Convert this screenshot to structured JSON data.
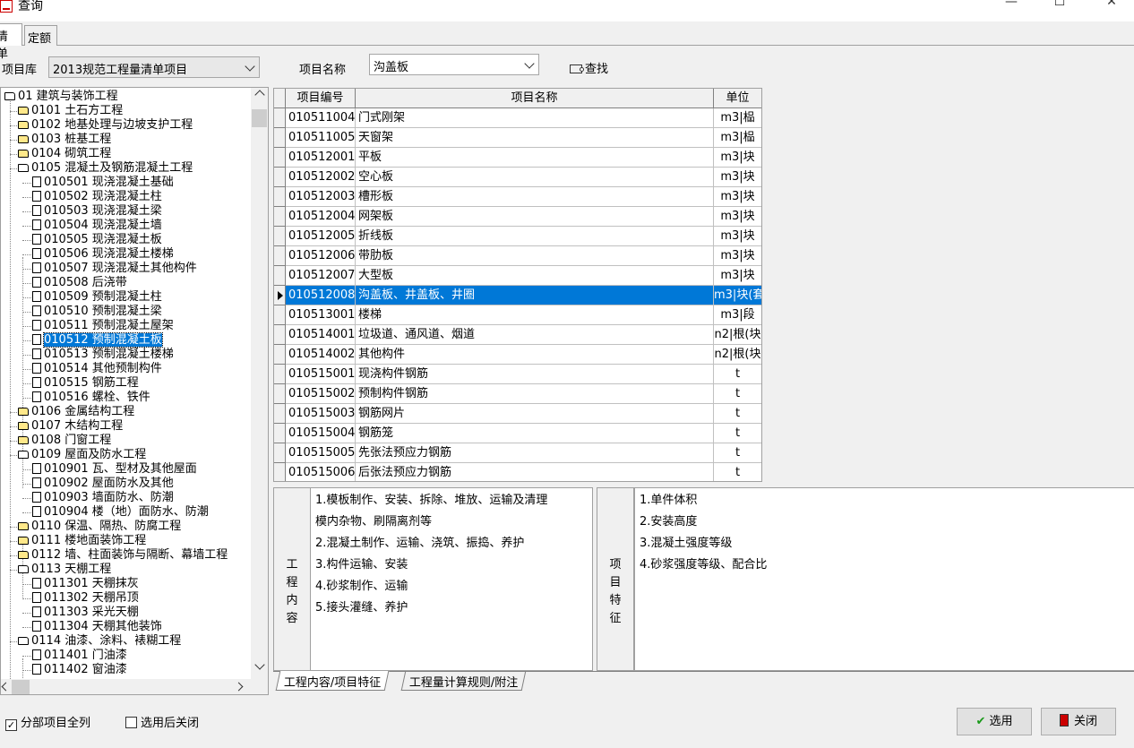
{
  "window": {
    "title": "查询",
    "min": "—",
    "max": "☐",
    "close": "✕"
  },
  "tabs": [
    "清单",
    "定额"
  ],
  "toolbar": {
    "library_label": "项目库",
    "library_value": "2013规范工程量清单项目",
    "name_label": "项目名称",
    "name_value": "沟盖板",
    "find_label": "查找"
  },
  "tree": [
    {
      "label": "01 建筑与装饰工程",
      "level": 0,
      "type": "folder-open"
    },
    {
      "label": "0101 土石方工程",
      "level": 1,
      "type": "folder"
    },
    {
      "label": "0102 地基处理与边坡支护工程",
      "level": 1,
      "type": "folder"
    },
    {
      "label": "0103 桩基工程",
      "level": 1,
      "type": "folder"
    },
    {
      "label": "0104 砌筑工程",
      "level": 1,
      "type": "folder"
    },
    {
      "label": "0105 混凝土及钢筋混凝土工程",
      "level": 1,
      "type": "folder-open"
    },
    {
      "label": "010501 现浇混凝土基础",
      "level": 2,
      "type": "doc"
    },
    {
      "label": "010502 现浇混凝土柱",
      "level": 2,
      "type": "doc"
    },
    {
      "label": "010503 现浇混凝土梁",
      "level": 2,
      "type": "doc"
    },
    {
      "label": "010504 现浇混凝土墙",
      "level": 2,
      "type": "doc"
    },
    {
      "label": "010505 现浇混凝土板",
      "level": 2,
      "type": "doc"
    },
    {
      "label": "010506 现浇混凝土楼梯",
      "level": 2,
      "type": "doc"
    },
    {
      "label": "010507 现浇混凝土其他构件",
      "level": 2,
      "type": "doc"
    },
    {
      "label": "010508 后浇带",
      "level": 2,
      "type": "doc"
    },
    {
      "label": "010509 预制混凝土柱",
      "level": 2,
      "type": "doc"
    },
    {
      "label": "010510 预制混凝土梁",
      "level": 2,
      "type": "doc"
    },
    {
      "label": "010511 预制混凝土屋架",
      "level": 2,
      "type": "doc"
    },
    {
      "label": "010512 预制混凝土板",
      "level": 2,
      "type": "doc",
      "selected": true
    },
    {
      "label": "010513 预制混凝土楼梯",
      "level": 2,
      "type": "doc"
    },
    {
      "label": "010514 其他预制构件",
      "level": 2,
      "type": "doc"
    },
    {
      "label": "010515 钢筋工程",
      "level": 2,
      "type": "doc"
    },
    {
      "label": "010516 螺栓、铁件",
      "level": 2,
      "type": "doc"
    },
    {
      "label": "0106 金属结构工程",
      "level": 1,
      "type": "folder"
    },
    {
      "label": "0107 木结构工程",
      "level": 1,
      "type": "folder"
    },
    {
      "label": "0108 门窗工程",
      "level": 1,
      "type": "folder"
    },
    {
      "label": "0109 屋面及防水工程",
      "level": 1,
      "type": "folder-open"
    },
    {
      "label": "010901 瓦、型材及其他屋面",
      "level": 2,
      "type": "doc"
    },
    {
      "label": "010902 屋面防水及其他",
      "level": 2,
      "type": "doc"
    },
    {
      "label": "010903 墙面防水、防潮",
      "level": 2,
      "type": "doc"
    },
    {
      "label": "010904 楼（地）面防水、防潮",
      "level": 2,
      "type": "doc"
    },
    {
      "label": "0110 保温、隔热、防腐工程",
      "level": 1,
      "type": "folder"
    },
    {
      "label": "0111 楼地面装饰工程",
      "level": 1,
      "type": "folder"
    },
    {
      "label": "0112 墙、柱面装饰与隔断、幕墙工程",
      "level": 1,
      "type": "folder"
    },
    {
      "label": "0113 天棚工程",
      "level": 1,
      "type": "folder-open"
    },
    {
      "label": "011301 天棚抹灰",
      "level": 2,
      "type": "doc"
    },
    {
      "label": "011302 天棚吊顶",
      "level": 2,
      "type": "doc"
    },
    {
      "label": "011303 采光天棚",
      "level": 2,
      "type": "doc"
    },
    {
      "label": "011304 天棚其他装饰",
      "level": 2,
      "type": "doc"
    },
    {
      "label": "0114 油漆、涂料、裱糊工程",
      "level": 1,
      "type": "folder-open"
    },
    {
      "label": "011401 门油漆",
      "level": 2,
      "type": "doc"
    },
    {
      "label": "011402 窗油漆",
      "level": 2,
      "type": "doc"
    }
  ],
  "grid": {
    "columns": [
      "项目编号",
      "项目名称",
      "单位"
    ],
    "rows": [
      [
        "010511004",
        "门式刚架",
        "m3|榀"
      ],
      [
        "010511005",
        "天窗架",
        "m3|榀"
      ],
      [
        "010512001",
        "平板",
        "m3|块"
      ],
      [
        "010512002",
        "空心板",
        "m3|块"
      ],
      [
        "010512003",
        "槽形板",
        "m3|块"
      ],
      [
        "010512004",
        "网架板",
        "m3|块"
      ],
      [
        "010512005",
        "折线板",
        "m3|块"
      ],
      [
        "010512006",
        "带肋板",
        "m3|块"
      ],
      [
        "010512007",
        "大型板",
        "m3|块"
      ],
      [
        "010512008",
        "沟盖板、井盖板、井圈",
        "m3|块(套"
      ],
      [
        "010513001",
        "楼梯",
        "m3|段"
      ],
      [
        "010514001",
        "垃圾道、通风道、烟道",
        "n2|根(块"
      ],
      [
        "010514002",
        "其他构件",
        "n2|根(块"
      ],
      [
        "010515001",
        "现浇构件钢筋",
        "t"
      ],
      [
        "010515002",
        "预制构件钢筋",
        "t"
      ],
      [
        "010515003",
        "钢筋网片",
        "t"
      ],
      [
        "010515004",
        "钢筋笼",
        "t"
      ],
      [
        "010515005",
        "先张法预应力钢筋",
        "t"
      ],
      [
        "010515006",
        "后张法预应力钢筋",
        "t"
      ]
    ],
    "selected_index": 9
  },
  "work_content": {
    "label": "工程内容",
    "lines": [
      "1.模板制作、安装、拆除、堆放、运输及清理",
      "模内杂物、刷隔离剂等",
      "2.混凝土制作、运输、浇筑、振捣、养护",
      "3.构件运输、安装",
      "4.砂浆制作、运输",
      "5.接头灌缝、养护"
    ]
  },
  "features": {
    "label": "项目特征",
    "lines": [
      "1.单件体积",
      "2.安装高度",
      "3.混凝土强度等级",
      "4.砂浆强度等级、配合比"
    ]
  },
  "bottom_tabs": [
    "工程内容/项目特征",
    "工程量计算规则/附注"
  ],
  "options": {
    "list_all": "分部项目全列",
    "close_after": "选用后关闭"
  },
  "buttons": {
    "select": "选用",
    "close": "关闭"
  }
}
